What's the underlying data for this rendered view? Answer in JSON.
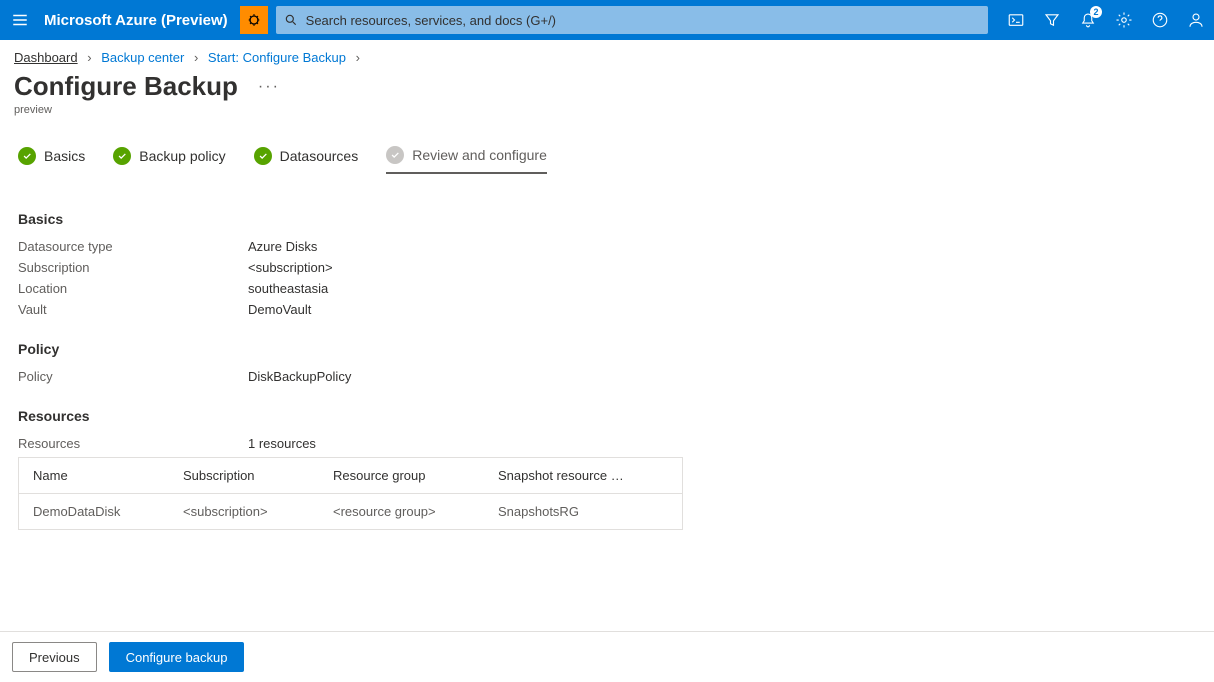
{
  "topbar": {
    "brand": "Microsoft Azure (Preview)",
    "search_placeholder": "Search resources, services, and docs (G+/)",
    "notification_count": "2"
  },
  "breadcrumb": {
    "items": [
      "Dashboard",
      "Backup center",
      "Start: Configure Backup"
    ]
  },
  "page": {
    "title": "Configure Backup",
    "subtitle": "preview"
  },
  "steps": [
    {
      "label": "Basics",
      "state": "done"
    },
    {
      "label": "Backup policy",
      "state": "done"
    },
    {
      "label": "Datasources",
      "state": "done"
    },
    {
      "label": "Review and configure",
      "state": "active"
    }
  ],
  "basics": {
    "heading": "Basics",
    "rows": [
      {
        "k": "Datasource type",
        "v": "Azure Disks"
      },
      {
        "k": "Subscription",
        "v": "<subscription>"
      },
      {
        "k": "Location",
        "v": "southeastasia"
      },
      {
        "k": "Vault",
        "v": "DemoVault"
      }
    ]
  },
  "policy": {
    "heading": "Policy",
    "rows": [
      {
        "k": "Policy",
        "v": "DiskBackupPolicy"
      }
    ]
  },
  "resources": {
    "heading": "Resources",
    "summary_k": "Resources",
    "summary_v": "1 resources",
    "columns": [
      "Name",
      "Subscription",
      "Resource group",
      "Snapshot resource …"
    ],
    "rows": [
      {
        "name": "DemoDataDisk",
        "sub": "<subscription>",
        "rg": "<resource group>",
        "snap": "SnapshotsRG"
      }
    ]
  },
  "footer": {
    "previous": "Previous",
    "configure": "Configure backup"
  }
}
